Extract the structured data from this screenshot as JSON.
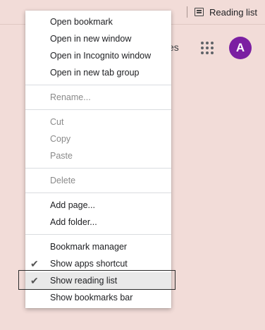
{
  "bookmarks_bar": {
    "reading_list_label": "Reading list"
  },
  "page": {
    "partial_text": "es",
    "avatar_letter": "A"
  },
  "menu": {
    "group1": [
      "Open bookmark",
      "Open in new window",
      "Open in Incognito window",
      "Open in new tab group"
    ],
    "group2": [
      "Rename..."
    ],
    "group3": [
      "Cut",
      "Copy",
      "Paste"
    ],
    "group4": [
      "Delete"
    ],
    "group5": [
      "Add page...",
      "Add folder..."
    ],
    "group6": [
      "Bookmark manager",
      "Show apps shortcut",
      "Show reading list",
      "Show bookmarks bar"
    ],
    "check_mark": "✔"
  },
  "colors": {
    "background": "#f2dcd8",
    "avatar": "#7b1fa2",
    "menu_bg": "#ffffff"
  }
}
